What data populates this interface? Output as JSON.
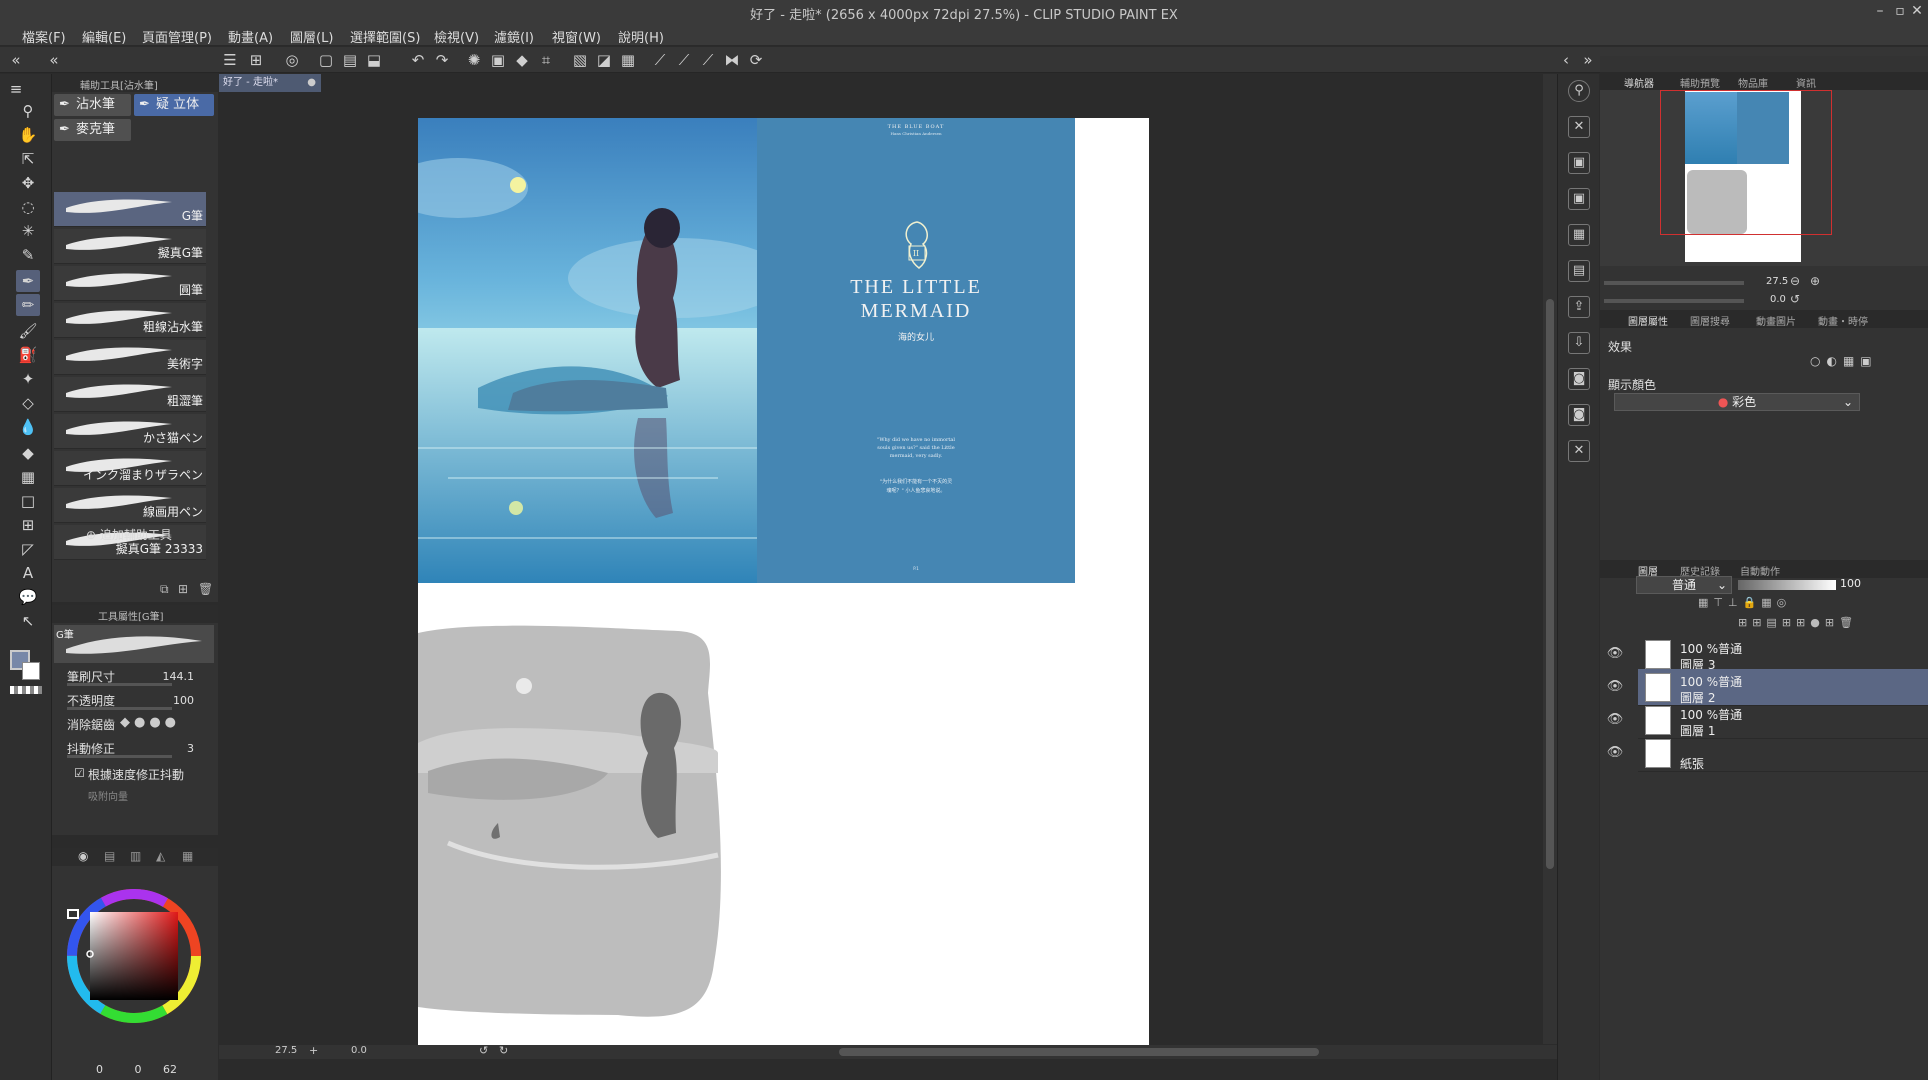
{
  "window": {
    "title": "好了 - 走啦* (2656 x 4000px 72dpi 27.5%) - CLIP STUDIO PAINT EX"
  },
  "menu": [
    "檔案(F)",
    "編輯(E)",
    "頁面管理(P)",
    "動畫(A)",
    "圖層(L)",
    "選擇範圍(S)",
    "檢視(V)",
    "濾鏡(I)",
    "視窗(W)",
    "說明(H)"
  ],
  "subtool": {
    "header": "輔助工具[沾水筆]",
    "tabs": [
      "沾水筆",
      "疑 立体",
      "麥克筆"
    ],
    "brushes": [
      "G筆",
      "擬真G筆",
      "圓筆",
      "粗線沾水筆",
      "美術字",
      "粗澀筆",
      "かさ猫ペン",
      "インク溜まりザラペン",
      "線画用ペン",
      "擬真G筆 23333"
    ],
    "add_label": "追加輔助工具"
  },
  "toolprop": {
    "header": "工具屬性[G筆]",
    "preset": "G筆",
    "brush_size_label": "筆刷尺寸",
    "brush_size": "144.1",
    "opacity_label": "不透明度",
    "opacity": "100",
    "antialias_label": "消除鋸齒",
    "stabilize_label": "抖動修正",
    "stabilize": "3",
    "speed_label": "根據速度修正抖動",
    "vector_label": "吸附向量"
  },
  "color": {
    "r": "0",
    "g": "0",
    "b": "62",
    "accent": "#c83a3a"
  },
  "canvas": {
    "doc_tab": "好了 - 走啦*",
    "zoom": "27.5",
    "rotation": "0.0",
    "book": {
      "series": "THE BLUE BOAT",
      "subtitle": "Hans Christian Andersen",
      "title_line1": "THE LITTLE",
      "title_line2": "MERMAID",
      "title_cn": "海的女儿",
      "quote_en_1": "\"Why did we have no immortal",
      "quote_en_2": "souls given us?\" said the Little",
      "quote_en_3": "mermaid, very sadly.",
      "quote_cn_1": "\"为什么我们不能有一个不灭的灵",
      "quote_cn_2": "魂呢？\" 小人鱼悲哀地说。",
      "page_no": "P.1",
      "roman": "II"
    }
  },
  "navigator": {
    "tab": "導航器",
    "tab2": "輔助預覽",
    "tab3": "物品庫",
    "tab4": "資訊",
    "zoom": "27.5",
    "angle": "0.0"
  },
  "layer_props": {
    "tab": "圖層屬性",
    "tab2": "圖層搜尋",
    "tab3": "動畫圖片",
    "tab4": "動畫・時停",
    "effect_label": "效果",
    "display_color_label": "顯示顏色",
    "display_color": "彩色"
  },
  "layers_panel": {
    "tab": "圖層",
    "tab2": "歷史記錄",
    "tab3": "自動動作",
    "blend_mode": "普通",
    "opacity": "100",
    "layers": [
      {
        "mode": "100 %普通",
        "name": "圖層 3"
      },
      {
        "mode": "100 %普通",
        "name": "圖層 2"
      },
      {
        "mode": "100 %普通",
        "name": "圖層 1"
      },
      {
        "mode": "",
        "name": "紙張"
      }
    ]
  }
}
